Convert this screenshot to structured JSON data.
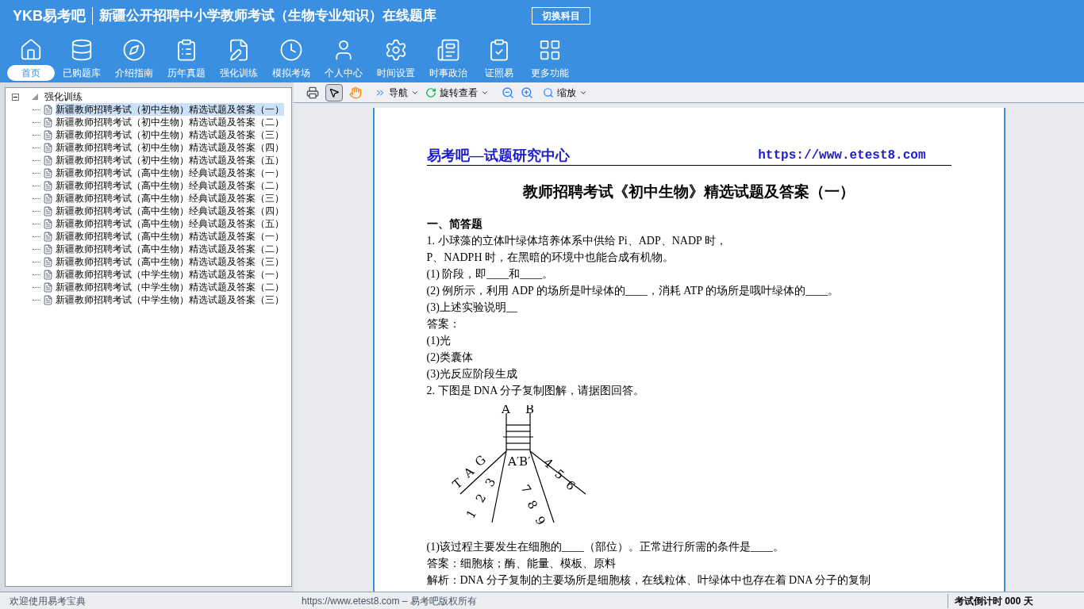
{
  "header": {
    "logo": "YKB易考吧",
    "title": "新疆公开招聘中小学教师考试（生物专业知识）在线题库",
    "switch_button": "切换科目"
  },
  "nav": [
    {
      "label": "首页",
      "selected": true
    },
    {
      "label": "已购题库",
      "selected": false
    },
    {
      "label": "介绍指南",
      "selected": false
    },
    {
      "label": "历年真题",
      "selected": false
    },
    {
      "label": "强化训练",
      "selected": false
    },
    {
      "label": "模拟考场",
      "selected": false
    },
    {
      "label": "个人中心",
      "selected": false
    },
    {
      "label": "时间设置",
      "selected": false
    },
    {
      "label": "时事政治",
      "selected": false
    },
    {
      "label": "证照易",
      "selected": false
    },
    {
      "label": "更多功能",
      "selected": false
    }
  ],
  "tree": {
    "label": "强化训练",
    "expanded": true,
    "children": [
      {
        "label": "新疆教师招聘考试（初中生物）精选试题及答案（一）",
        "selected": true
      },
      {
        "label": "新疆教师招聘考试（初中生物）精选试题及答案（二）",
        "selected": false
      },
      {
        "label": "新疆教师招聘考试（初中生物）精选试题及答案（三）",
        "selected": false
      },
      {
        "label": "新疆教师招聘考试（初中生物）精选试题及答案（四）",
        "selected": false
      },
      {
        "label": "新疆教师招聘考试（初中生物）精选试题及答案（五）",
        "selected": false
      },
      {
        "label": "新疆教师招聘考试（高中生物）经典试题及答案（一）",
        "selected": false
      },
      {
        "label": "新疆教师招聘考试（高中生物）经典试题及答案（二）",
        "selected": false
      },
      {
        "label": "新疆教师招聘考试（高中生物）经典试题及答案（三）",
        "selected": false
      },
      {
        "label": "新疆教师招聘考试（高中生物）经典试题及答案（四）",
        "selected": false
      },
      {
        "label": "新疆教师招聘考试（高中生物）经典试题及答案（五）",
        "selected": false
      },
      {
        "label": "新疆教师招聘考试（高中生物）精选试题及答案（一）",
        "selected": false
      },
      {
        "label": "新疆教师招聘考试（高中生物）精选试题及答案（二）",
        "selected": false
      },
      {
        "label": "新疆教师招聘考试（高中生物）精选试题及答案（三）",
        "selected": false
      },
      {
        "label": "新疆教师招聘考试（中学生物）精选试题及答案（一）",
        "selected": false
      },
      {
        "label": "新疆教师招聘考试（中学生物）精选试题及答案（二）",
        "selected": false
      },
      {
        "label": "新疆教师招聘考试（中学生物）精选试题及答案（三）",
        "selected": false
      }
    ]
  },
  "toolbar": {
    "navigate": "导航",
    "rotate": "旋转查看",
    "zoom": "缩放",
    "select_tool_selected": true
  },
  "document": {
    "brand": "易考吧—试题研究中心",
    "url": "https://www.etest8.com",
    "title": "教师招聘考试《初中生物》精选试题及答案（一）",
    "section": "一、简答题",
    "lines": [
      "1. 小球藻的立体叶绿体培养体系中供给 Pi、ADP、NADP 时，",
      "P、NADPH 时，在黑暗的环境中也能合成有机物。",
      "(1) 阶段，即____和____。",
      "(2) 例所示，利用 ADP 的场所是叶绿体的____，消耗 ATP 的场所是哦叶绿体的____。",
      "(3)上述实验说明__",
      "答案：",
      "(1)光",
      "(2)类囊体",
      "(3)光反应阶段生成",
      "2. 下图是 DNA 分子复制图解，请据图回答。"
    ],
    "figure_labels": [
      "A",
      "B",
      "T",
      "A",
      "G",
      "A′",
      "B′",
      "4",
      "5",
      "6",
      "1",
      "2",
      "3",
      "7",
      "8",
      "9"
    ],
    "after": [
      "(1)该过程主要发生在细胞的____（部位）。正常进行所需的条件是____。",
      "答案：细胞核；酶、能量、模板、原料",
      "解析：DNA 分子复制的主要场所是细胞核，在线粒体、叶绿体中也存在着 DNA 分子的复制"
    ]
  },
  "status_bar": {
    "welcome": "欢迎使用易考宝典",
    "copyright": "https://www.etest8.com – 易考吧版权所有",
    "countdown": "考试倒计时 000 天"
  }
}
